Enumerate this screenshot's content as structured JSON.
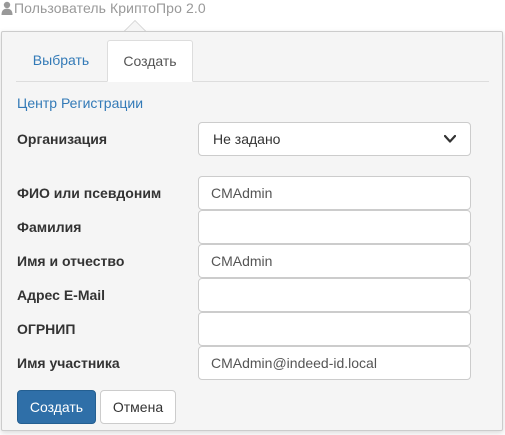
{
  "header": {
    "user_icon": "user-icon",
    "user_label": "Пользователь КриптоПро 2.0"
  },
  "tabs": [
    {
      "label": "Выбрать",
      "active": false
    },
    {
      "label": "Создать",
      "active": true
    }
  ],
  "section_title": "Центр Регистрации",
  "form": {
    "organization": {
      "label": "Организация",
      "value": "Не задано"
    },
    "fio": {
      "label": "ФИО или псевдоним",
      "value": "CMAdmin"
    },
    "surname": {
      "label": "Фамилия",
      "value": ""
    },
    "given_name": {
      "label": "Имя и отчество",
      "value": "CMAdmin"
    },
    "email": {
      "label": "Адрес E-Mail",
      "value": ""
    },
    "ogrnip": {
      "label": "ОГРНИП",
      "value": ""
    },
    "participant": {
      "label": "Имя участника",
      "value": "CMAdmin@indeed-id.local"
    }
  },
  "buttons": {
    "create": "Создать",
    "cancel": "Отмена"
  },
  "colors": {
    "link": "#337ab7",
    "primary": "#2f6fa8",
    "panel_bg": "#f5f5f5"
  }
}
